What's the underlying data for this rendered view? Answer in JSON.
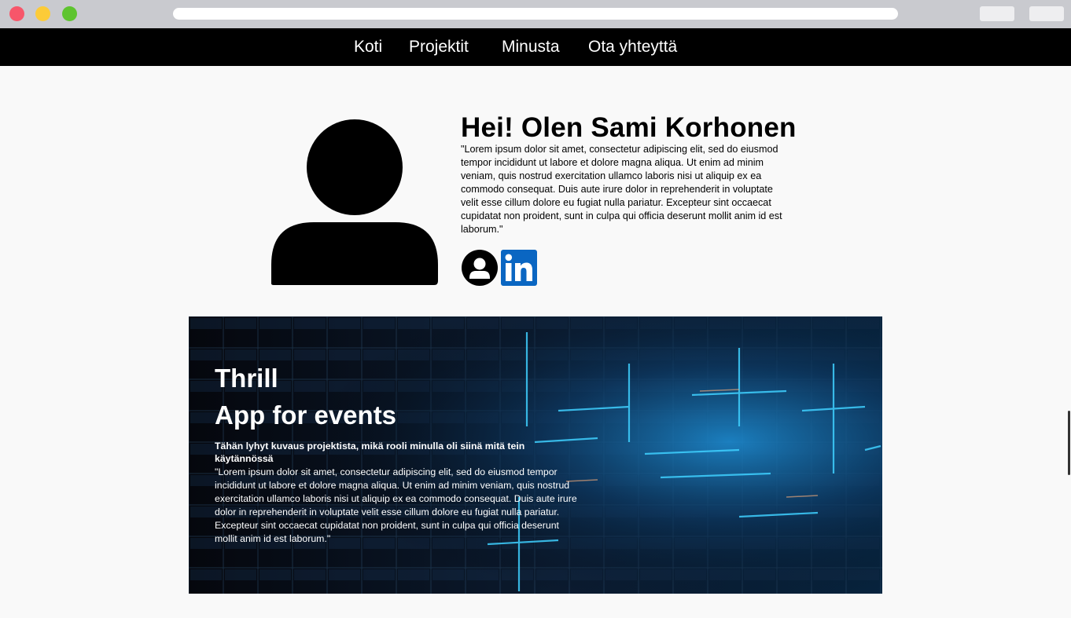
{
  "nav": {
    "items": [
      "Koti",
      "Projektit",
      "Minusta",
      "Ota yhteyttä"
    ]
  },
  "hero": {
    "title": "Hei! Olen Sami Korhonen",
    "text": "\"Lorem ipsum dolor sit amet, consectetur adipiscing elit, sed do eiusmod tempor incididunt ut labore et dolore magna aliqua. Ut enim ad minim veniam, quis nostrud exercitation ullamco laboris nisi ut aliquip ex ea commodo consequat. Duis aute irure dolor in reprehenderit in voluptate velit esse cillum dolore eu fugiat nulla pariatur. Excepteur sint occaecat cupidatat non proident, sunt in culpa qui officia deserunt mollit anim id est laborum.\"",
    "social": [
      {
        "icon": "user-circle-icon"
      },
      {
        "icon": "linkedin-icon",
        "color": "#0a66c2"
      }
    ]
  },
  "project": {
    "title_line1": "Thrill",
    "title_line2": "App for events",
    "subtitle": "Tähän lyhyt kuvaus projektista, mikä rooli minulla oli siinä mitä tein käytännössä",
    "text": "\"Lorem ipsum dolor sit amet, consectetur adipiscing elit, sed do eiusmod tempor incididunt ut labore et dolore magna aliqua. Ut enim ad minim veniam, quis nostrud exercitation ullamco laboris nisi ut aliquip ex ea commodo consequat. Duis aute irure dolor in reprehenderit in voluptate velit esse cillum dolore eu fugiat nulla pariatur. Excepteur sint occaecat cupidatat non proident, sunt in culpa qui officia deserunt mollit anim id est laborum.\""
  },
  "colors": {
    "nav_bg": "#000000",
    "page_bg": "#f9f9f9",
    "accent_glow": "#2fb8ff",
    "linkedin": "#0a66c2"
  }
}
